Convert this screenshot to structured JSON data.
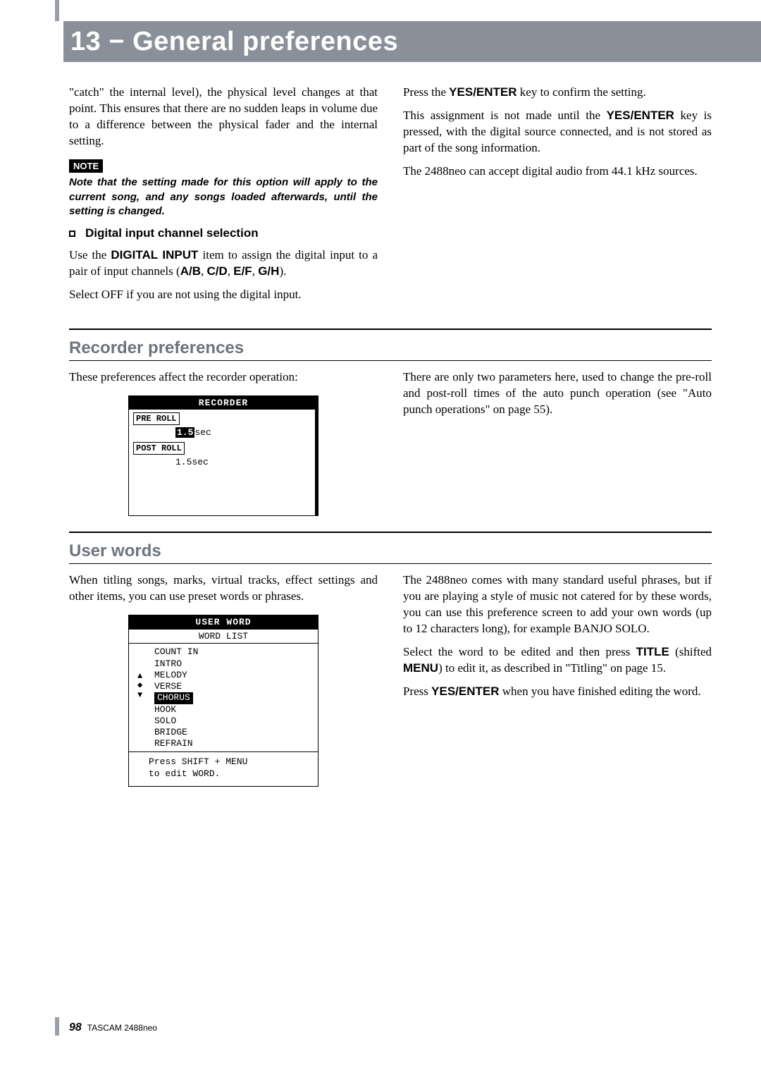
{
  "header": {
    "title": "13 − General preferences"
  },
  "intro": {
    "left_p1": "\"catch\" the internal level), the physical level changes at that point. This ensures that there are no sudden leaps in volume due to a difference between the physical fader and the internal setting.",
    "note_label": "NOTE",
    "note_text": "Note that the setting made for this option will apply to the current song, and any songs loaded afterwards, until the setting is changed.",
    "subhead": "Digital input channel selection",
    "left_p2_a": "Use the ",
    "left_p2_b": "DIGITAL INPUT",
    "left_p2_c": " item to assign the digital input to a pair of input channels (",
    "left_p2_d": "A/B",
    "left_p2_e": ", ",
    "left_p2_f": "C/D",
    "left_p2_g": ", ",
    "left_p2_h": "E/F",
    "left_p2_i": ", ",
    "left_p2_j": "G/H",
    "left_p2_k": ").",
    "left_p3": "Select OFF if you are not using the digital input.",
    "right_p1_a": "Press the ",
    "right_p1_b": "YES/ENTER",
    "right_p1_c": " key to confirm the setting.",
    "right_p2_a": "This assignment is not made until the ",
    "right_p2_b": "YES/ENTER",
    "right_p2_c": " key is pressed, with the digital source connected, and is not stored as part of the song information.",
    "right_p3": "The 2488neo can accept digital audio from 44.1 kHz sources."
  },
  "recorder": {
    "heading": "Recorder preferences",
    "left_p1": "These preferences affect the recorder operation:",
    "right_p1": "There are only two parameters here, used to change the pre-roll and post-roll times of the auto punch operation (see \"Auto punch operations\" on page 55).",
    "lcd_title": "RECORDER",
    "lcd_pre_label": "PRE ROLL",
    "lcd_pre_hl": "1.5",
    "lcd_pre_unit": "sec",
    "lcd_post_label": "POST ROLL",
    "lcd_post_val": "1.5sec"
  },
  "userwords": {
    "heading": "User words",
    "left_p1": "When titling songs, marks, virtual tracks, effect settings and other items, you can use preset words or phrases.",
    "right_p1": "The 2488neo comes with many standard useful phrases, but if you are playing a style of music not catered for by these words, you can use this preference screen to add your own words (up to 12 characters long), for example BANJO SOLO.",
    "right_p2_a": "Select the word to be edited and then press ",
    "right_p2_b": "TITLE",
    "right_p2_c": " (shifted ",
    "right_p2_d": "MENU",
    "right_p2_e": ") to edit it, as described in \"Titling\" on page 15.",
    "right_p3_a": "Press ",
    "right_p3_b": "YES/ENTER",
    "right_p3_c": " when you have finished editing the word.",
    "lcd_title": "USER WORD",
    "lcd_sub": "WORD LIST",
    "lcd_items": [
      "COUNT IN",
      "INTRO",
      "MELODY",
      "VERSE",
      "CHORUS",
      "HOOK",
      "SOLO",
      "BRIDGE",
      "REFRAIN"
    ],
    "lcd_selected_index": 4,
    "lcd_hint1": "Press SHIFT + MENU",
    "lcd_hint2": "to edit WORD."
  },
  "footer": {
    "page": "98",
    "product": "TASCAM  2488neo"
  }
}
